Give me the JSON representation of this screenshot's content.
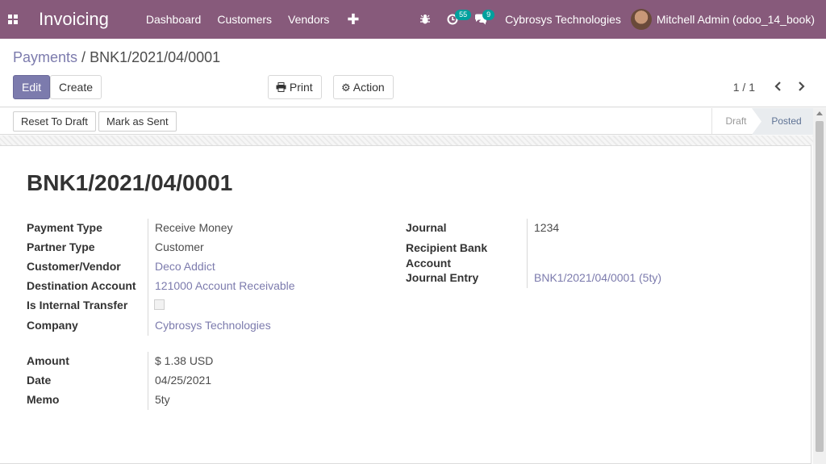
{
  "navbar": {
    "brand": "Invoicing",
    "menu": [
      "Dashboard",
      "Customers",
      "Vendors"
    ],
    "plus": "✚",
    "activity_count": "55",
    "messages_count": "9",
    "company": "Cybrosys Technologies",
    "user": "Mitchell Admin (odoo_14_book)"
  },
  "breadcrumb": {
    "parent": "Payments",
    "separator": " / ",
    "current": "BNK1/2021/04/0001"
  },
  "buttons": {
    "edit": "Edit",
    "create": "Create",
    "print": "Print",
    "action": "Action"
  },
  "pager": {
    "value": "1 / 1"
  },
  "statusbar": {
    "reset": "Reset To Draft",
    "mark_sent": "Mark as Sent",
    "stages": [
      "Draft",
      "Posted"
    ],
    "active_stage": "Posted"
  },
  "record": {
    "title": "BNK1/2021/04/0001",
    "left_fields": [
      {
        "label": "Payment Type",
        "value": "Receive Money"
      },
      {
        "label": "Partner Type",
        "value": "Customer"
      },
      {
        "label": "Customer/Vendor",
        "value": "Deco Addict"
      },
      {
        "label": "Destination Account",
        "value": "121000 Account Receivable"
      },
      {
        "label": "Is Internal Transfer",
        "value": ""
      },
      {
        "label": "Company",
        "value": "Cybrosys Technologies"
      }
    ],
    "amount_fields": [
      {
        "label": "Amount",
        "value": "$ 1.38  USD"
      },
      {
        "label": "Date",
        "value": "04/25/2021"
      },
      {
        "label": "Memo",
        "value": "5ty"
      }
    ],
    "right_fields": [
      {
        "label": "Journal",
        "value": "1234"
      },
      {
        "label": "Recipient Bank Account",
        "label_line1": "Recipient Bank",
        "label_line2": "Account",
        "value": ""
      },
      {
        "label": "Journal Entry",
        "value": "BNK1/2021/04/0001 (5ty)"
      }
    ]
  },
  "colors": {
    "navbar": "#875a7b",
    "primary": "#7c7bad",
    "link": "#7c7bad"
  }
}
